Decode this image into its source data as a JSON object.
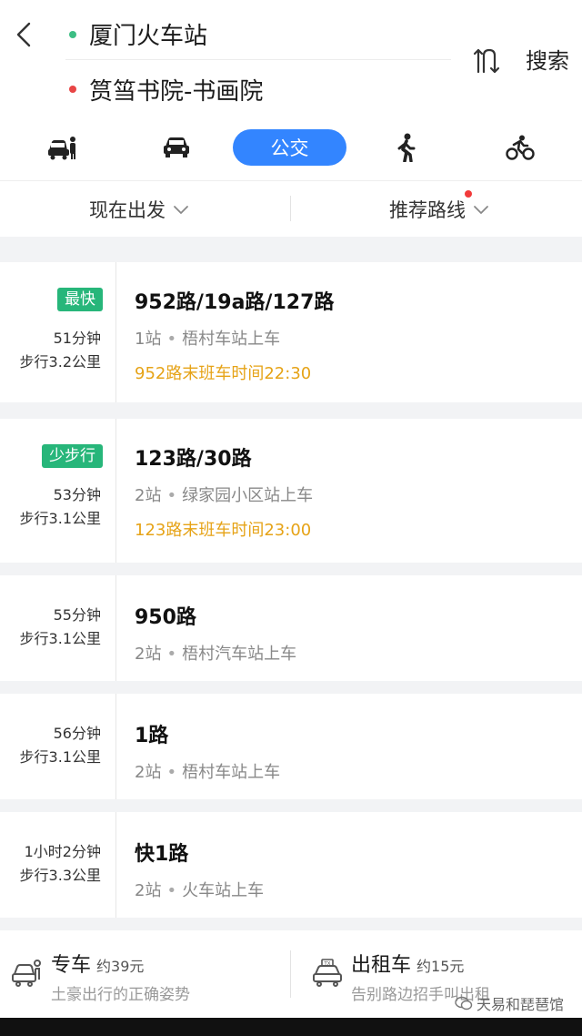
{
  "header": {
    "from": "厦门火车站",
    "to": "筼筜书院-书画院",
    "search_label": "搜索",
    "from_dot_color": "#3dbe84",
    "to_dot_color": "#e84545"
  },
  "modes": [
    {
      "name": "drive",
      "icon": "car-with-person-icon"
    },
    {
      "name": "car",
      "icon": "car-icon"
    },
    {
      "name": "bus",
      "label": "公交",
      "icon": "bus",
      "active": true
    },
    {
      "name": "walk",
      "icon": "walking-icon"
    },
    {
      "name": "bike",
      "icon": "bicycle-icon"
    }
  ],
  "filters": {
    "depart": "现在出发",
    "route_pref": "推荐路线"
  },
  "routes": [
    {
      "tag": "最快",
      "time": "51分钟",
      "walk": "步行3.2公里",
      "name": "952路/19a路/127路",
      "stops": "1站",
      "board": "梧村车站上车",
      "last_bus": "952路末班车时间22:30"
    },
    {
      "tag": "少步行",
      "time": "53分钟",
      "walk": "步行3.1公里",
      "name": "123路/30路",
      "stops": "2站",
      "board": "绿家园小区站上车",
      "last_bus": "123路末班车时间23:00"
    },
    {
      "time": "55分钟",
      "walk": "步行3.1公里",
      "name": "950路",
      "stops": "2站",
      "board": "梧村汽车站上车"
    },
    {
      "time": "56分钟",
      "walk": "步行3.1公里",
      "name": "1路",
      "stops": "2站",
      "board": "梧村车站上车"
    },
    {
      "time": "1小时2分钟",
      "walk": "步行3.3公里",
      "name": "快1路",
      "stops": "2站",
      "board": "火车站上车"
    }
  ],
  "separator": "•",
  "bottom": {
    "private_car": {
      "title": "专车",
      "price": "约39元",
      "sub": "土豪出行的正确姿势"
    },
    "taxi": {
      "title": "出租车",
      "price": "约15元",
      "sub": "告别路边招手叫出租"
    }
  },
  "watermark": "天易和琵琶馆",
  "colors": {
    "accent": "#3385ff",
    "tag_green": "#27b67a",
    "last_bus_orange": "#e6a317"
  }
}
